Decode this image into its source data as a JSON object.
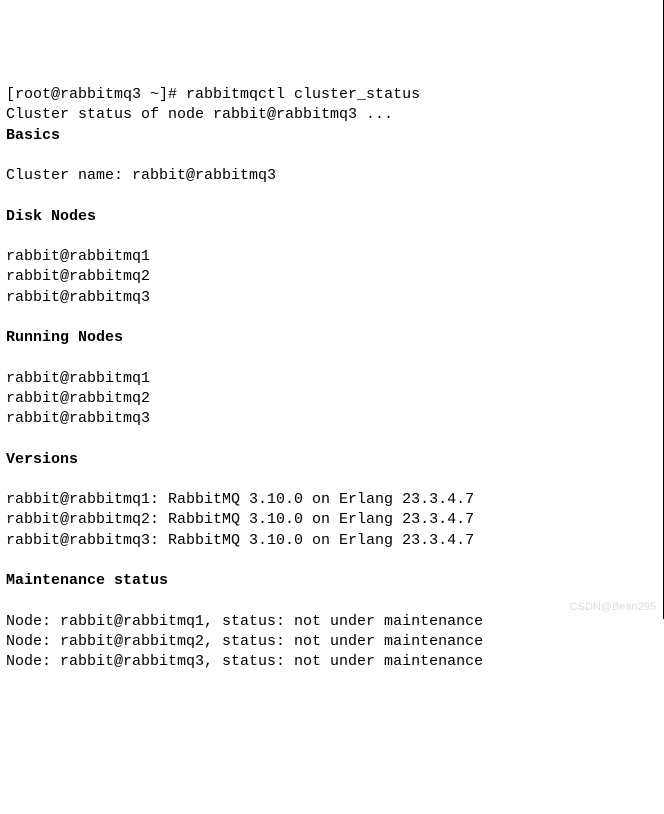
{
  "terminal": {
    "prompt": "[root@rabbitmq3 ~]# ",
    "command": "rabbitmqctl cluster_status",
    "status_line": "Cluster status of node rabbit@rabbitmq3 ...",
    "sections": {
      "basics": {
        "heading": "Basics",
        "cluster_name_label": "Cluster name: ",
        "cluster_name_value": "rabbit@rabbitmq3"
      },
      "disk_nodes": {
        "heading": "Disk Nodes",
        "nodes": [
          "rabbit@rabbitmq1",
          "rabbit@rabbitmq2",
          "rabbit@rabbitmq3"
        ]
      },
      "running_nodes": {
        "heading": "Running Nodes",
        "nodes": [
          "rabbit@rabbitmq1",
          "rabbit@rabbitmq2",
          "rabbit@rabbitmq3"
        ]
      },
      "versions": {
        "heading": "Versions",
        "lines": [
          "rabbit@rabbitmq1: RabbitMQ 3.10.0 on Erlang 23.3.4.7",
          "rabbit@rabbitmq2: RabbitMQ 3.10.0 on Erlang 23.3.4.7",
          "rabbit@rabbitmq3: RabbitMQ 3.10.0 on Erlang 23.3.4.7"
        ]
      },
      "maintenance": {
        "heading": "Maintenance status",
        "lines": [
          "Node: rabbit@rabbitmq1, status: not under maintenance",
          "Node: rabbit@rabbitmq2, status: not under maintenance",
          "Node: rabbit@rabbitmq3, status: not under maintenance"
        ]
      }
    }
  },
  "watermark": "CSDN@Bean295"
}
